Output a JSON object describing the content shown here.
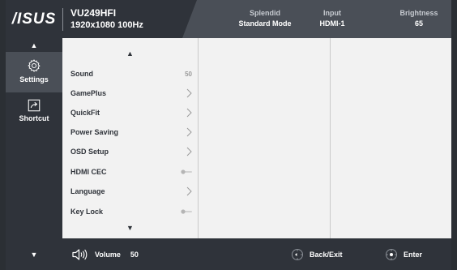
{
  "header": {
    "brand": "/ISUS",
    "model": "VU249HFI",
    "resolution": "1920x1080 100Hz",
    "status": [
      {
        "title": "Splendid",
        "value": "Standard Mode"
      },
      {
        "title": "Input",
        "value": "HDMI-1"
      },
      {
        "title": "Brightness",
        "value": "65"
      }
    ]
  },
  "sidebar": {
    "items": [
      {
        "label": "Settings",
        "icon": "gear-icon",
        "active": true
      },
      {
        "label": "Shortcut",
        "icon": "shortcut-icon",
        "active": false
      }
    ]
  },
  "menu": {
    "items": [
      {
        "label": "Sound",
        "value": "50",
        "control": "value"
      },
      {
        "label": "GamePlus",
        "control": "chevron"
      },
      {
        "label": "QuickFit",
        "control": "chevron"
      },
      {
        "label": "Power Saving",
        "control": "chevron"
      },
      {
        "label": "OSD Setup",
        "control": "chevron"
      },
      {
        "label": "HDMI CEC",
        "control": "toggle"
      },
      {
        "label": "Language",
        "control": "chevron"
      },
      {
        "label": "Key Lock",
        "control": "toggle"
      }
    ]
  },
  "footer": {
    "volume_label": "Volume",
    "volume_value": "50",
    "back_label": "Back/Exit",
    "enter_label": "Enter"
  },
  "colors": {
    "panel_dark": "#2f333a",
    "panel_mid": "#4a4f57",
    "menu_bg": "#f2f2f2",
    "menu_text": "#2f333a"
  }
}
